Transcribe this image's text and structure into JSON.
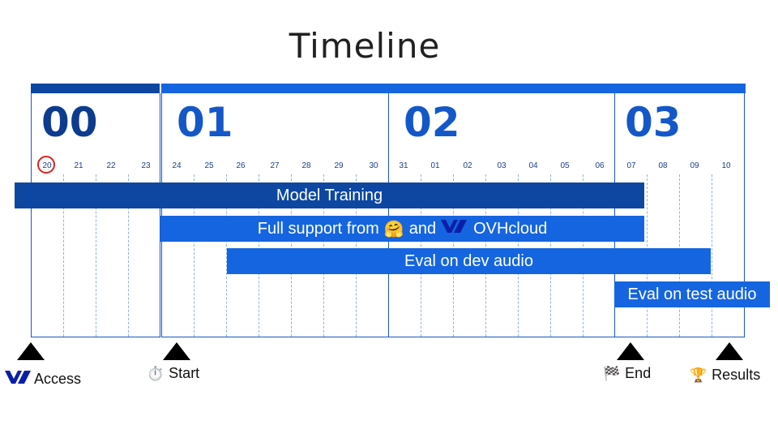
{
  "title": "Timeline",
  "weeks": [
    "00",
    "01",
    "02",
    "03"
  ],
  "days": [
    "20",
    "21",
    "22",
    "23",
    "24",
    "25",
    "26",
    "27",
    "28",
    "29",
    "30",
    "31",
    "01",
    "02",
    "03",
    "04",
    "05",
    "06",
    "07",
    "08",
    "09",
    "10"
  ],
  "highlighted_day": "20",
  "bars": {
    "training": "Model Training",
    "support_prefix": "Full support from",
    "support_and": "and",
    "support_suffix": "OVHcloud",
    "dev": "Eval on dev audio",
    "test": "Eval on test audio"
  },
  "milestones": {
    "access": "Access",
    "start": "Start",
    "end": "End",
    "results": "Results"
  },
  "icons": {
    "hugging": "🤗",
    "stopwatch": "⏱️",
    "flag": "🏁",
    "trophy": "🏆"
  },
  "colors": {
    "dark_blue": "#0d47a1",
    "blue": "#1565e0",
    "text_dark": "#212121"
  }
}
